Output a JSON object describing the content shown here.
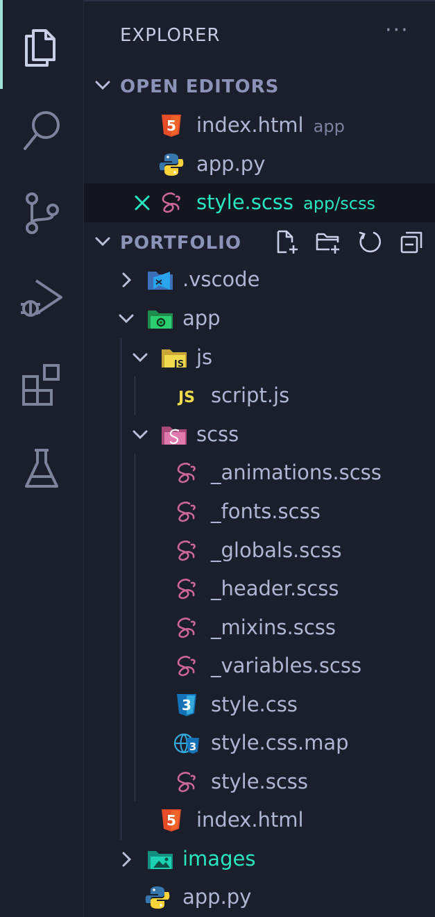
{
  "activity_bar": {
    "icons": [
      "explorer-icon",
      "search-icon",
      "source-control-icon",
      "run-debug-icon",
      "extensions-icon",
      "testing-icon"
    ],
    "active_color": "#9fe1d6"
  },
  "sidebar": {
    "title": "EXPLORER",
    "more": "···",
    "open_editors": {
      "label": "OPEN EDITORS",
      "items": [
        {
          "name": "index.html",
          "path": "app",
          "icon": "html-file-icon"
        },
        {
          "name": "app.py",
          "path": "",
          "icon": "python-file-icon"
        },
        {
          "name": "style.scss",
          "path": "app/scss",
          "icon": "sass-file-icon",
          "active": true
        }
      ]
    },
    "portfolio": {
      "label": "PORTFOLIO",
      "actions": [
        "new-file-icon",
        "new-folder-icon",
        "refresh-icon",
        "collapse-all-icon"
      ],
      "tree": [
        {
          "name": ".vscode",
          "type": "folder",
          "expanded": false,
          "icon": "vscode-folder-icon"
        },
        {
          "name": "app",
          "type": "folder",
          "expanded": true,
          "icon": "app-folder-icon"
        },
        {
          "name": "js",
          "type": "folder",
          "expanded": true,
          "icon": "js-folder-icon"
        },
        {
          "name": "script.js",
          "type": "file",
          "icon": "javascript-file-icon"
        },
        {
          "name": "scss",
          "type": "folder",
          "expanded": true,
          "icon": "sass-folder-icon"
        },
        {
          "name": "_animations.scss",
          "type": "file",
          "icon": "sass-file-icon"
        },
        {
          "name": "_fonts.scss",
          "type": "file",
          "icon": "sass-file-icon"
        },
        {
          "name": "_globals.scss",
          "type": "file",
          "icon": "sass-file-icon"
        },
        {
          "name": "_header.scss",
          "type": "file",
          "icon": "sass-file-icon"
        },
        {
          "name": "_mixins.scss",
          "type": "file",
          "icon": "sass-file-icon"
        },
        {
          "name": "_variables.scss",
          "type": "file",
          "icon": "sass-file-icon"
        },
        {
          "name": "style.css",
          "type": "file",
          "icon": "css-file-icon"
        },
        {
          "name": "style.css.map",
          "type": "file",
          "icon": "css-map-file-icon"
        },
        {
          "name": "style.scss",
          "type": "file",
          "icon": "sass-file-icon"
        },
        {
          "name": "index.html",
          "type": "file",
          "icon": "html-file-icon"
        },
        {
          "name": "images",
          "type": "folder",
          "expanded": false,
          "icon": "images-folder-icon",
          "modified": true
        },
        {
          "name": "app.py",
          "type": "file",
          "icon": "python-file-icon"
        }
      ]
    }
  },
  "colors": {
    "background": "#1b1e2b",
    "text": "#aeb6d4",
    "accent": "#27e6c0",
    "section_header": "#8b93b8",
    "html": "#e44d26",
    "sass": "#cd6799",
    "css": "#1572b6",
    "js": "#f0db4f",
    "python_blue": "#3776ab",
    "python_yellow": "#ffd43b"
  }
}
